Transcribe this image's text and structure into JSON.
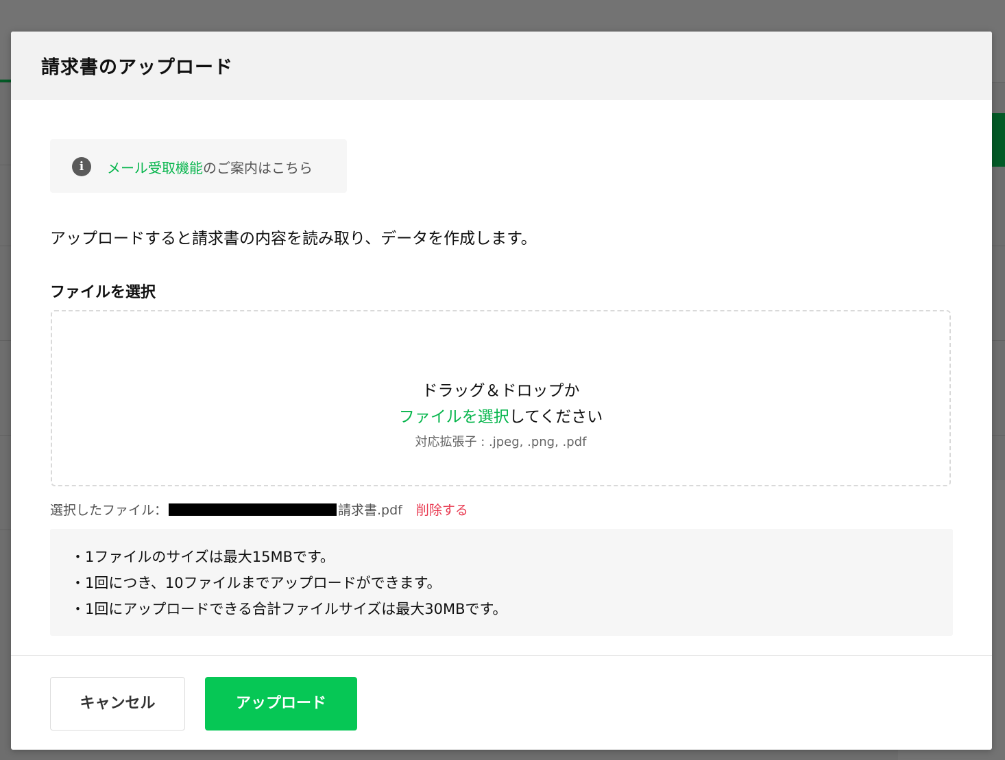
{
  "modal": {
    "title": "請求書のアップロード",
    "info": {
      "icon": "info-icon",
      "link_text": "メール受取機能",
      "text": "のご案内はこちら"
    },
    "description": "アップロードすると請求書の内容を読み取り、データを作成します。",
    "file_section_label": "ファイルを選択",
    "dropzone": {
      "line1": "ドラッグ＆ドロップか",
      "select_link": "ファイルを選択",
      "line2_suffix": "してください",
      "extensions": "対応拡張子 : .jpeg, .png, .pdf"
    },
    "selected_file": {
      "label": "選択したファイル：",
      "filename_suffix": "請求書.pdf",
      "delete": "削除する"
    },
    "notes": [
      "・1ファイルのサイズは最大15MBです。",
      "・1回につき、10ファイルまでアップロードができます。",
      "・1回にアップロードできる合計ファイルサイズは最大30MBです。"
    ],
    "buttons": {
      "cancel": "キャンセル",
      "upload": "アップロード"
    }
  },
  "colors": {
    "accent_green": "#06c755",
    "link_green": "#06b54c",
    "delete_red": "#e8384f",
    "overlay": "#6f6f6f"
  }
}
